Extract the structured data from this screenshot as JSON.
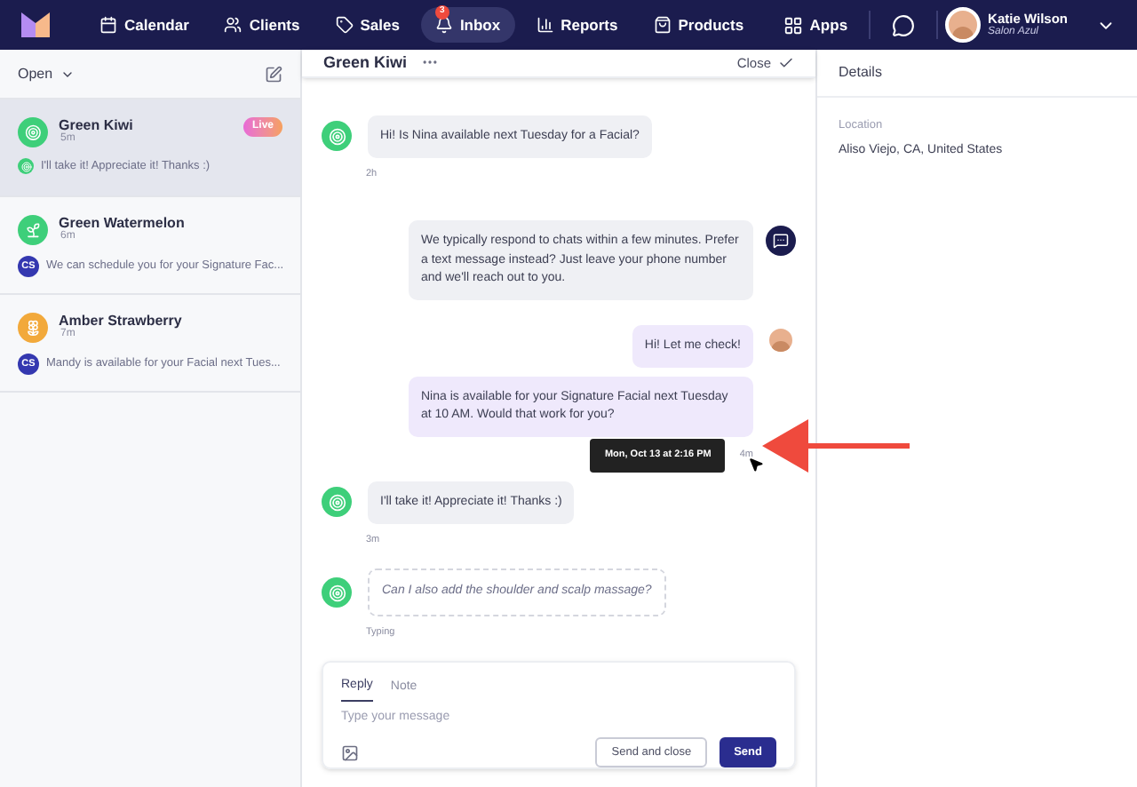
{
  "nav": {
    "items": [
      {
        "label": "Calendar",
        "selected": false
      },
      {
        "label": "Clients",
        "selected": false
      },
      {
        "label": "Sales",
        "selected": false
      },
      {
        "label": "Inbox",
        "selected": true,
        "badge": "3"
      },
      {
        "label": "Reports",
        "selected": false
      },
      {
        "label": "Products",
        "selected": false
      }
    ],
    "apps": "Apps",
    "user": {
      "name": "Katie Wilson",
      "subtitle": "Salon Azul"
    }
  },
  "sidebar": {
    "filter": "Open",
    "conversations": [
      {
        "name": "Green Kiwi",
        "time": "5m",
        "preview": "I'll take it! Appreciate it! Thanks :)",
        "badge": "Live",
        "selected": true,
        "color": "#3ecf7a"
      },
      {
        "name": "Green Watermelon",
        "time": "6m",
        "preview": "We can schedule you for your Signature Fac...",
        "selected": false,
        "color": "#3ecf7a",
        "initials": "CS"
      },
      {
        "name": "Amber Strawberry",
        "time": "7m",
        "preview": "Mandy is available for your Facial next Tues...",
        "selected": false,
        "color": "#f2a93b",
        "initials": "CS"
      }
    ]
  },
  "conversation": {
    "title": "Green Kiwi",
    "close": "Close",
    "messages": [
      {
        "kind": "incoming",
        "text": "Hi! Is Nina available next Tuesday for a Facial?",
        "time": "2h"
      },
      {
        "kind": "auto",
        "text": "We typically respond to chats within a few minutes. Prefer a text message instead? Just leave your phone number and we'll reach out to you."
      },
      {
        "kind": "outgoing",
        "text": "Hi! Let me check!"
      },
      {
        "kind": "outgoing",
        "text": "Nina is available for your Signature Facial next Tuesday at 10 AM. Would that work for you?",
        "time": "4m",
        "tooltip": "Mon, Oct 13 at 2:16 PM"
      },
      {
        "kind": "incoming",
        "text": "I'll take it! Appreciate it! Thanks :)",
        "time": "3m"
      },
      {
        "kind": "typing",
        "text": "Can I also add the shoulder and scalp massage?",
        "time": "Typing"
      }
    ],
    "composer": {
      "tabs": [
        {
          "label": "Reply",
          "selected": true
        },
        {
          "label": "Note",
          "selected": false
        }
      ],
      "placeholder": "Type your message",
      "send_close": "Send and close",
      "send": "Send"
    }
  },
  "details": {
    "title": "Details",
    "fields": [
      {
        "label": "Location",
        "value": "Aliso Viejo, CA, United States"
      }
    ]
  }
}
